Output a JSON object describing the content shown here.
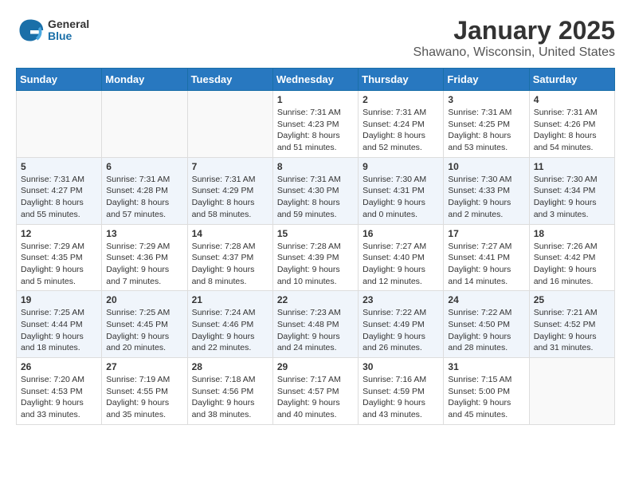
{
  "header": {
    "logo": {
      "general": "General",
      "blue": "Blue"
    },
    "title": "January 2025",
    "location": "Shawano, Wisconsin, United States"
  },
  "weekdays": [
    "Sunday",
    "Monday",
    "Tuesday",
    "Wednesday",
    "Thursday",
    "Friday",
    "Saturday"
  ],
  "weeks": [
    [
      {
        "day": "",
        "info": ""
      },
      {
        "day": "",
        "info": ""
      },
      {
        "day": "",
        "info": ""
      },
      {
        "day": "1",
        "info": "Sunrise: 7:31 AM\nSunset: 4:23 PM\nDaylight: 8 hours and 51 minutes."
      },
      {
        "day": "2",
        "info": "Sunrise: 7:31 AM\nSunset: 4:24 PM\nDaylight: 8 hours and 52 minutes."
      },
      {
        "day": "3",
        "info": "Sunrise: 7:31 AM\nSunset: 4:25 PM\nDaylight: 8 hours and 53 minutes."
      },
      {
        "day": "4",
        "info": "Sunrise: 7:31 AM\nSunset: 4:26 PM\nDaylight: 8 hours and 54 minutes."
      }
    ],
    [
      {
        "day": "5",
        "info": "Sunrise: 7:31 AM\nSunset: 4:27 PM\nDaylight: 8 hours and 55 minutes."
      },
      {
        "day": "6",
        "info": "Sunrise: 7:31 AM\nSunset: 4:28 PM\nDaylight: 8 hours and 57 minutes."
      },
      {
        "day": "7",
        "info": "Sunrise: 7:31 AM\nSunset: 4:29 PM\nDaylight: 8 hours and 58 minutes."
      },
      {
        "day": "8",
        "info": "Sunrise: 7:31 AM\nSunset: 4:30 PM\nDaylight: 8 hours and 59 minutes."
      },
      {
        "day": "9",
        "info": "Sunrise: 7:30 AM\nSunset: 4:31 PM\nDaylight: 9 hours and 0 minutes."
      },
      {
        "day": "10",
        "info": "Sunrise: 7:30 AM\nSunset: 4:33 PM\nDaylight: 9 hours and 2 minutes."
      },
      {
        "day": "11",
        "info": "Sunrise: 7:30 AM\nSunset: 4:34 PM\nDaylight: 9 hours and 3 minutes."
      }
    ],
    [
      {
        "day": "12",
        "info": "Sunrise: 7:29 AM\nSunset: 4:35 PM\nDaylight: 9 hours and 5 minutes."
      },
      {
        "day": "13",
        "info": "Sunrise: 7:29 AM\nSunset: 4:36 PM\nDaylight: 9 hours and 7 minutes."
      },
      {
        "day": "14",
        "info": "Sunrise: 7:28 AM\nSunset: 4:37 PM\nDaylight: 9 hours and 8 minutes."
      },
      {
        "day": "15",
        "info": "Sunrise: 7:28 AM\nSunset: 4:39 PM\nDaylight: 9 hours and 10 minutes."
      },
      {
        "day": "16",
        "info": "Sunrise: 7:27 AM\nSunset: 4:40 PM\nDaylight: 9 hours and 12 minutes."
      },
      {
        "day": "17",
        "info": "Sunrise: 7:27 AM\nSunset: 4:41 PM\nDaylight: 9 hours and 14 minutes."
      },
      {
        "day": "18",
        "info": "Sunrise: 7:26 AM\nSunset: 4:42 PM\nDaylight: 9 hours and 16 minutes."
      }
    ],
    [
      {
        "day": "19",
        "info": "Sunrise: 7:25 AM\nSunset: 4:44 PM\nDaylight: 9 hours and 18 minutes."
      },
      {
        "day": "20",
        "info": "Sunrise: 7:25 AM\nSunset: 4:45 PM\nDaylight: 9 hours and 20 minutes."
      },
      {
        "day": "21",
        "info": "Sunrise: 7:24 AM\nSunset: 4:46 PM\nDaylight: 9 hours and 22 minutes."
      },
      {
        "day": "22",
        "info": "Sunrise: 7:23 AM\nSunset: 4:48 PM\nDaylight: 9 hours and 24 minutes."
      },
      {
        "day": "23",
        "info": "Sunrise: 7:22 AM\nSunset: 4:49 PM\nDaylight: 9 hours and 26 minutes."
      },
      {
        "day": "24",
        "info": "Sunrise: 7:22 AM\nSunset: 4:50 PM\nDaylight: 9 hours and 28 minutes."
      },
      {
        "day": "25",
        "info": "Sunrise: 7:21 AM\nSunset: 4:52 PM\nDaylight: 9 hours and 31 minutes."
      }
    ],
    [
      {
        "day": "26",
        "info": "Sunrise: 7:20 AM\nSunset: 4:53 PM\nDaylight: 9 hours and 33 minutes."
      },
      {
        "day": "27",
        "info": "Sunrise: 7:19 AM\nSunset: 4:55 PM\nDaylight: 9 hours and 35 minutes."
      },
      {
        "day": "28",
        "info": "Sunrise: 7:18 AM\nSunset: 4:56 PM\nDaylight: 9 hours and 38 minutes."
      },
      {
        "day": "29",
        "info": "Sunrise: 7:17 AM\nSunset: 4:57 PM\nDaylight: 9 hours and 40 minutes."
      },
      {
        "day": "30",
        "info": "Sunrise: 7:16 AM\nSunset: 4:59 PM\nDaylight: 9 hours and 43 minutes."
      },
      {
        "day": "31",
        "info": "Sunrise: 7:15 AM\nSunset: 5:00 PM\nDaylight: 9 hours and 45 minutes."
      },
      {
        "day": "",
        "info": ""
      }
    ]
  ]
}
